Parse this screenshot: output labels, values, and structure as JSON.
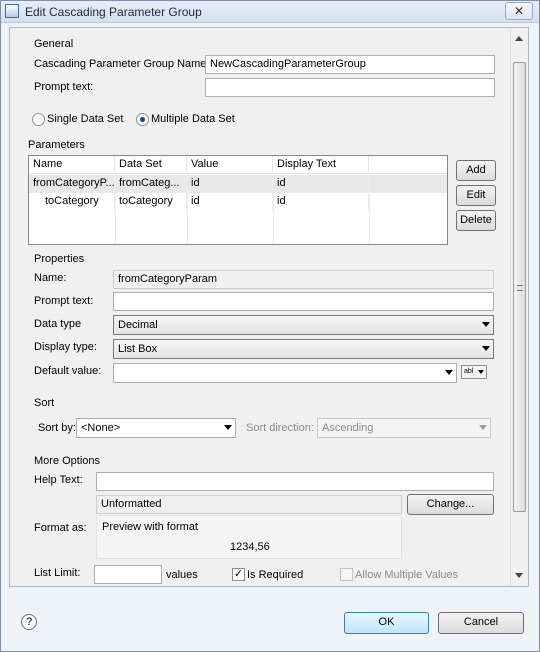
{
  "window": {
    "title": "Edit Cascading Parameter Group",
    "close_glyph": "✕"
  },
  "general": {
    "title": "General",
    "group_name_label": "Cascading Parameter Group Name:",
    "group_name_value": "NewCascadingParameterGroup",
    "prompt_label": "Prompt text:",
    "prompt_value": ""
  },
  "dataset_mode": {
    "single_label": "Single Data Set",
    "multiple_label": "Multiple Data Set",
    "selected": "multiple"
  },
  "parameters": {
    "title": "Parameters",
    "columns": [
      "Name",
      "Data Set",
      "Value",
      "Display Text"
    ],
    "rows": [
      {
        "name": "fromCategoryP...",
        "dataset": "fromCateg...",
        "value": "id",
        "display": "id"
      },
      {
        "name": "toCategory",
        "dataset": "toCategory",
        "value": "id",
        "display": "id"
      }
    ],
    "add_label": "Add",
    "edit_label": "Edit",
    "delete_label": "Delete"
  },
  "properties": {
    "title": "Properties",
    "name_label": "Name:",
    "name_value": "fromCategoryParam",
    "prompt_label": "Prompt text:",
    "prompt_value": "",
    "data_type_label": "Data type",
    "data_type_value": "Decimal",
    "display_type_label": "Display type:",
    "display_type_value": "List Box",
    "default_value_label": "Default value:",
    "default_value_value": "",
    "expr_button_label": "abl"
  },
  "sort": {
    "title": "Sort",
    "sort_by_label": "Sort by:",
    "sort_by_value": "<None>",
    "direction_label": "Sort direction:",
    "direction_value": "Ascending"
  },
  "more_options": {
    "title": "More Options",
    "help_text_label": "Help Text:",
    "help_text_value": "",
    "format_value": "Unformatted",
    "change_label": "Change...",
    "format_as_label": "Format as:",
    "preview_label": "Preview with format",
    "preview_value": "1234,56",
    "list_limit_label": "List Limit:",
    "list_limit_value": "",
    "values_label": "values",
    "is_required_label": "Is Required",
    "is_required_checked": true,
    "allow_multiple_label": "Allow Multiple Values",
    "allow_multiple_checked": false,
    "check_glyph": "✓"
  },
  "footer": {
    "help_glyph": "?",
    "ok_label": "OK",
    "cancel_label": "Cancel"
  }
}
